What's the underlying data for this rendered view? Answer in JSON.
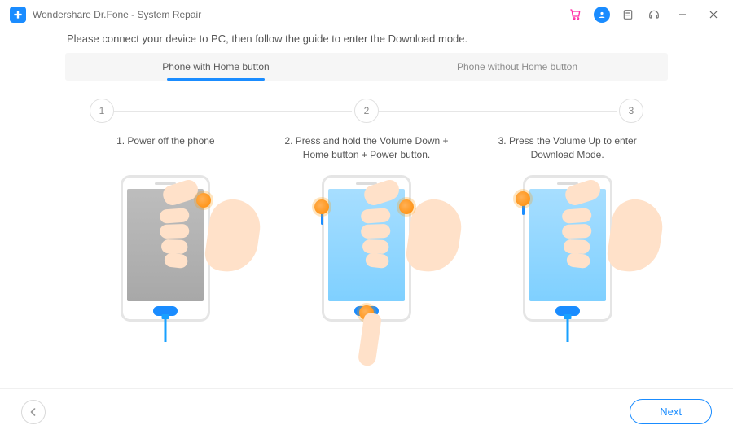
{
  "app": {
    "title": "Wondershare Dr.Fone - System Repair"
  },
  "instruction": "Please connect your device to PC, then follow the guide to enter the Download mode.",
  "tabs": [
    {
      "label": "Phone with Home button",
      "active": true
    },
    {
      "label": "Phone without Home button",
      "active": false
    }
  ],
  "steps": {
    "nums": [
      "1",
      "2",
      "3"
    ],
    "labels": [
      "1. Power off the phone",
      "2. Press and hold the Volume Down + Home button + Power button.",
      "3. Press the Volume Up to enter Download Mode."
    ]
  },
  "footer": {
    "next": "Next"
  }
}
